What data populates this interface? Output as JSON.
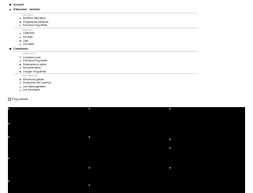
{
  "nav": {
    "top_items": [
      "Accueil",
      "S'abonner - Acheter"
    ],
    "groups": [
      {
        "header": "Lettres",
        "items": [
          "Numéros déjà parus",
          "Programmes parutions",
          "Pub dans Prog-éteste"
        ]
      },
      {
        "header": "Agenda",
        "items": [
          "Calendrier",
          "Par style",
          "Liste",
          "Les salles"
        ]
      },
      {
        "top_before": "Connexion",
        "header": "Contacts",
        "items": [
          "Contactez-nous",
          "Pub dans Prog-éteste",
          "Partenaires et radios",
          "Nos partenaires",
          "L'équipe Prog-éteste"
        ]
      },
      {
        "header": "Recherche",
        "items": [
          "Recherche globale",
          "Sommaires des numéros",
          "Les Indiéprogeables",
          "Les chroniques"
        ]
      }
    ]
  },
  "logo": {
    "alt": "Prog-éteste"
  },
  "stage": {
    "background": "#000000"
  }
}
